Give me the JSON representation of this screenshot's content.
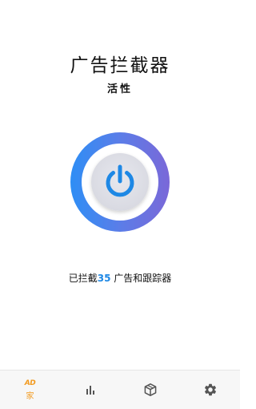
{
  "app": {
    "title": "广告拦截器",
    "status": "活性"
  },
  "stats": {
    "prefix": "已拦截",
    "count": "35",
    "suffix": " 广告和跟踪器"
  },
  "nav": {
    "home_badge": "AD",
    "home_label": "家",
    "items": [
      {
        "icon": "home-ad-icon",
        "label": "家",
        "active": true
      },
      {
        "icon": "bar-chart-icon",
        "active": false
      },
      {
        "icon": "box-icon",
        "active": false
      },
      {
        "icon": "gear-icon",
        "active": false
      }
    ]
  },
  "colors": {
    "accent": "#1e88e5",
    "ring_start": "#2e8ef5",
    "ring_end": "#7a68d8",
    "nav_active": "#f29a1f",
    "nav_inactive": "#555555"
  }
}
